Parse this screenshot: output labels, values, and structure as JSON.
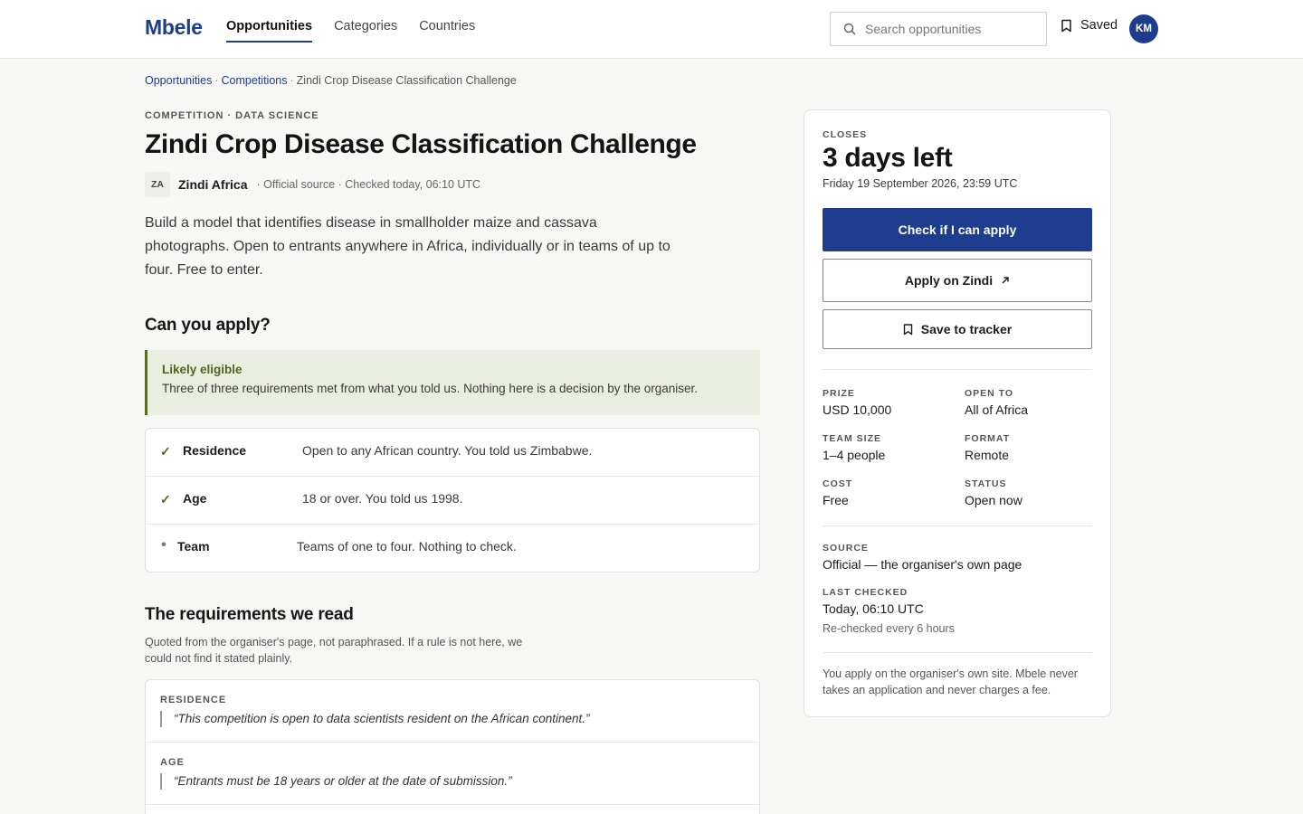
{
  "header": {
    "logo": "Mbele",
    "nav": [
      "Opportunities",
      "Categories",
      "Countries"
    ],
    "search_placeholder": "Search opportunities",
    "saved_label": "Saved",
    "avatar_initials": "KM"
  },
  "breadcrumb": {
    "items": [
      "Opportunities",
      "Competitions"
    ],
    "current": "Zindi Crop Disease Classification Challenge"
  },
  "opportunity": {
    "eyebrow": "COMPETITION · DATA SCIENCE",
    "title": "Zindi Crop Disease Classification Challenge",
    "org_badge": "ZA",
    "org_name": "Zindi Africa",
    "org_meta": "· Official source · Checked today, 06:10 UTC",
    "description": "Build a model that identifies disease in smallholder maize and cassava photographs. Open to entrants anywhere in Africa, individually or in teams of up to four. Free to enter."
  },
  "eligibility": {
    "heading": "Can you apply?",
    "verdict_title": "Likely eligible",
    "verdict_text": "Three of three requirements met from what you told us. Nothing here is a decision by the organiser.",
    "checks": [
      {
        "mark": "✓",
        "label": "Residence",
        "text": "Open to any African country. You told us Zimbabwe."
      },
      {
        "mark": "✓",
        "label": "Age",
        "text": "18 or over. You told us 1998."
      },
      {
        "mark": "•",
        "label": "Team",
        "text": "Teams of one to four. Nothing to check."
      }
    ]
  },
  "requirements": {
    "heading": "The requirements we read",
    "subtitle": "Quoted from the organiser's page, not paraphrased. If a rule is not here, we could not find it stated plainly.",
    "items": [
      {
        "key": "RESIDENCE",
        "quote": "“This competition is open to data scientists resident on the African continent.”"
      },
      {
        "key": "AGE",
        "quote": "“Entrants must be 18 years or older at the date of submission.”"
      }
    ]
  },
  "sidebar": {
    "closes_label": "CLOSES",
    "countdown": "3 days left",
    "close_date": "Friday 19 September 2026, 23:59 UTC",
    "primary_button": "Check if I can apply",
    "apply_button": "Apply on Zindi",
    "save_button": "Save to tracker",
    "facts": [
      {
        "label": "PRIZE",
        "value": "USD 10,000"
      },
      {
        "label": "OPEN TO",
        "value": "All of Africa"
      },
      {
        "label": "TEAM SIZE",
        "value": "1–4 people"
      },
      {
        "label": "FORMAT",
        "value": "Remote"
      },
      {
        "label": "COST",
        "value": "Free"
      },
      {
        "label": "STATUS",
        "value": "Open now"
      }
    ],
    "source_label": "SOURCE",
    "source_value": "Official — the organiser's own page",
    "checked_label": "LAST CHECKED",
    "checked_value": "Today, 06:10 UTC",
    "checked_note": "Re-checked every 6 hours",
    "footnote": "You apply on the organiser's own site. Mbele never takes an application and never charges a fee."
  },
  "colors": {
    "brand": "#1f3d8f",
    "eligible_bg": "#eaeee0",
    "eligible_accent": "#526322"
  }
}
